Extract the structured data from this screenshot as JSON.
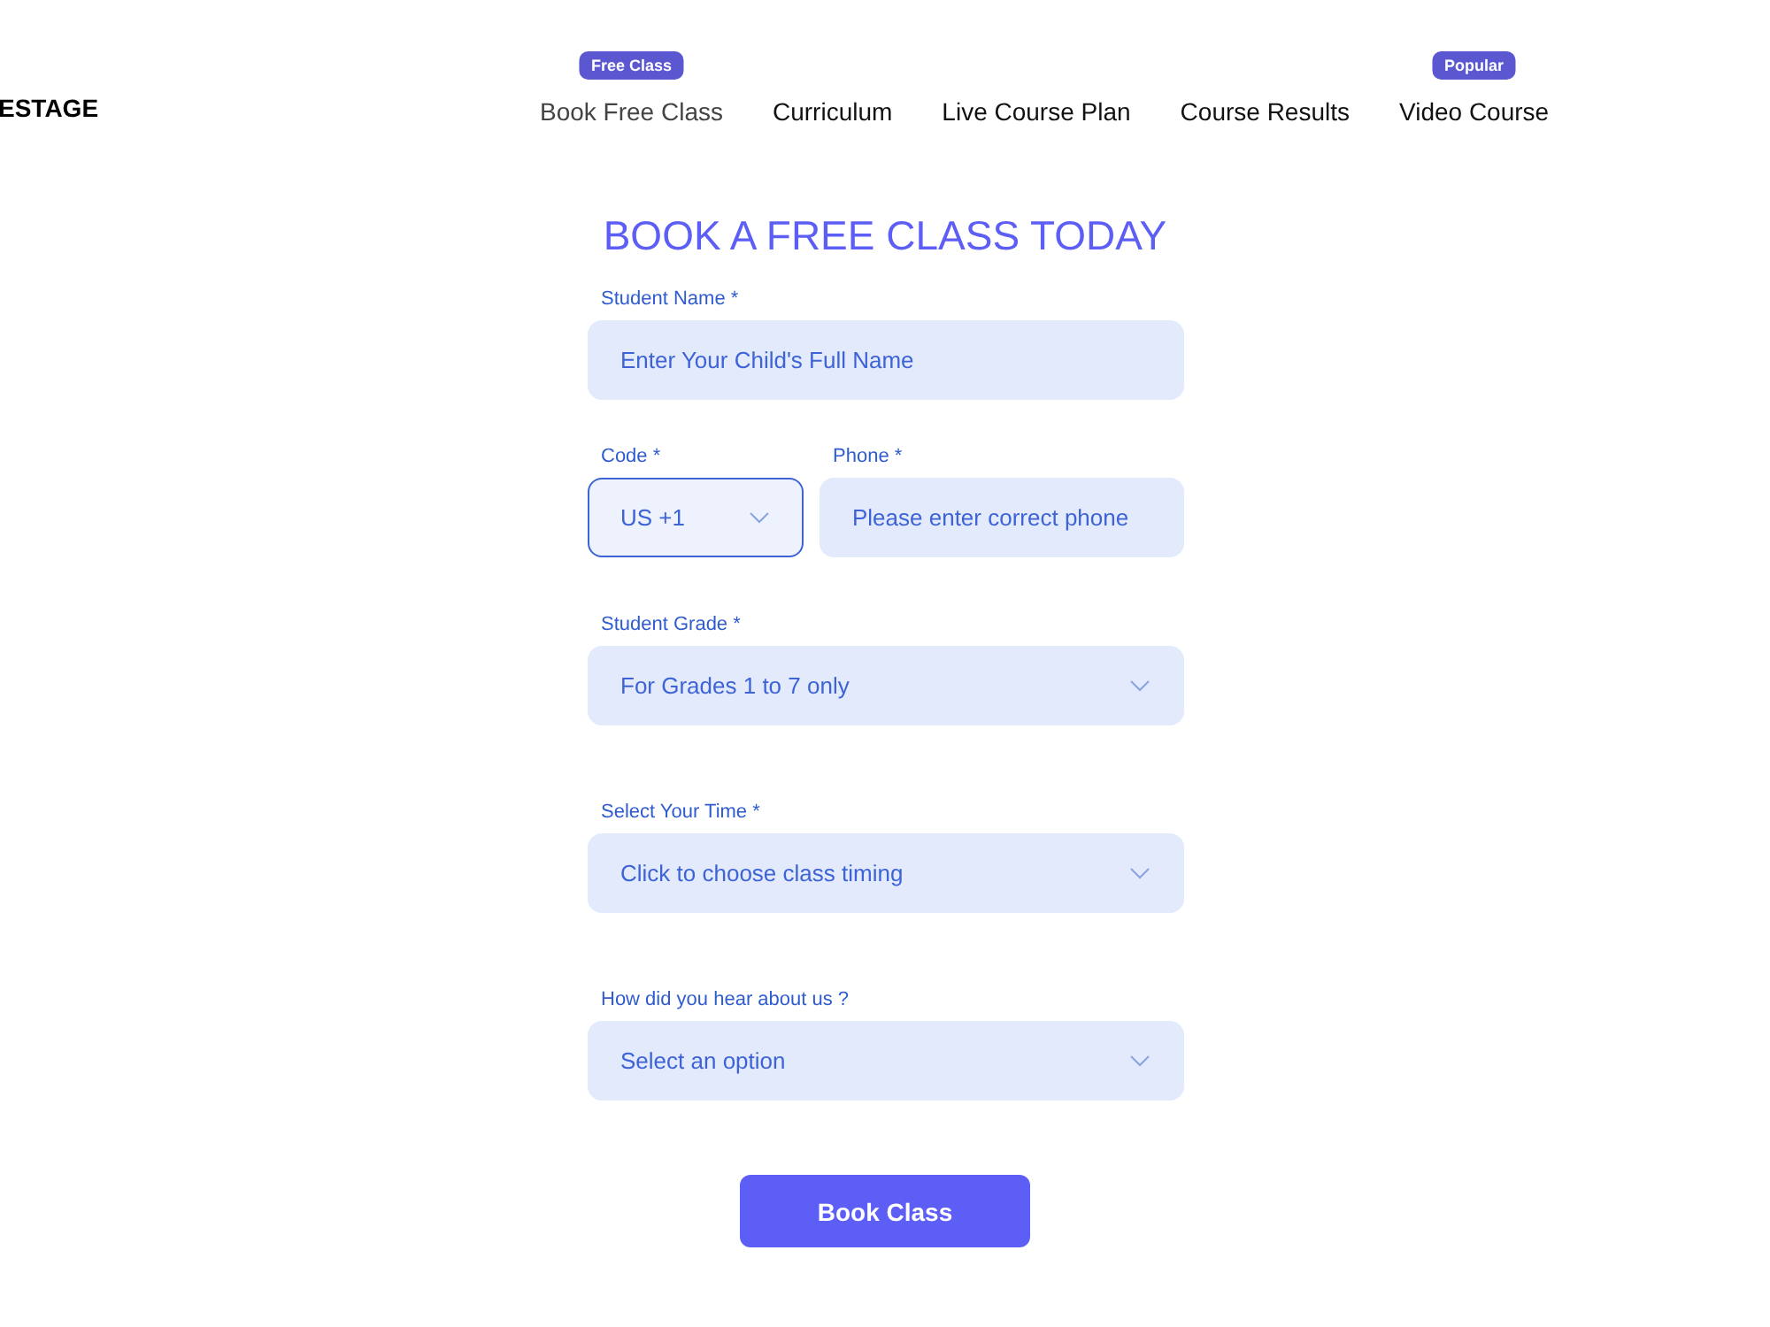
{
  "header": {
    "logo": "ESTAGE",
    "nav": [
      {
        "label": "Book Free Class",
        "selected": true,
        "badge": "Free Class"
      },
      {
        "label": "Curriculum",
        "selected": false
      },
      {
        "label": "Live Course Plan",
        "selected": false
      },
      {
        "label": "Course Results",
        "selected": false
      },
      {
        "label": "Video Course",
        "selected": false,
        "badge": "Popular"
      }
    ]
  },
  "form": {
    "title": "BOOK A FREE CLASS TODAY",
    "rows": [
      {
        "fields": [
          {
            "kind": "input",
            "label": "Student Name *",
            "placeholder": "Enter Your Child's Full Name",
            "focused": false
          }
        ]
      },
      {
        "fields": [
          {
            "kind": "select",
            "label": "Code *",
            "value": "US +1",
            "focused": true
          },
          {
            "kind": "input",
            "label": "Phone *",
            "placeholder": "Please enter correct phone",
            "focused": false
          }
        ]
      },
      {
        "fields": [
          {
            "kind": "select",
            "label": "Student Grade *",
            "value": "For Grades 1 to 7 only",
            "focused": false
          }
        ]
      },
      {
        "fields": [
          {
            "kind": "select",
            "label": "Select Your Time *",
            "value": "Click to choose class timing",
            "focused": false
          }
        ]
      },
      {
        "fields": [
          {
            "kind": "select",
            "label": "How did you hear about us ?",
            "value": "Select an option",
            "focused": false
          }
        ]
      }
    ],
    "submit": "Book Class"
  }
}
